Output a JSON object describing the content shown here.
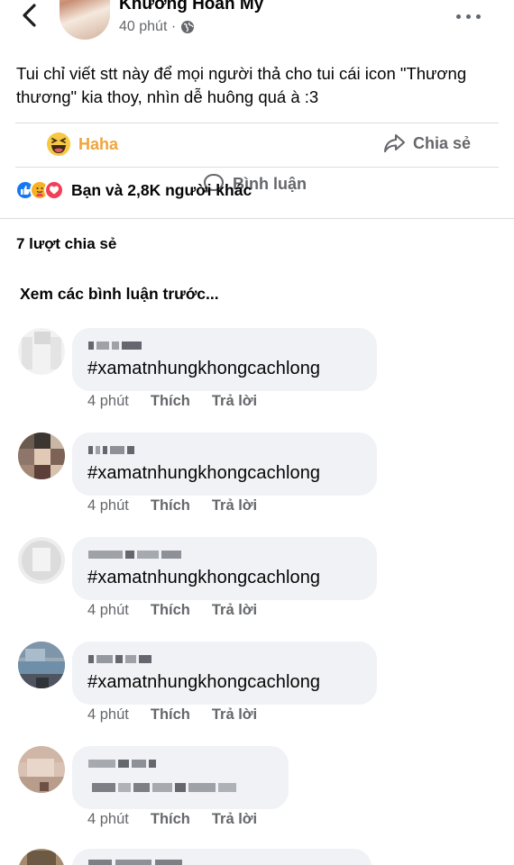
{
  "post": {
    "author": "Khương Hoàn My",
    "time": "40 phút ·",
    "text": "Tui chỉ viết stt này để mọi người thả cho tui cái icon \"Thương thương\" kia thoy, nhìn dễ huông quá à :3"
  },
  "actions": {
    "haha": "Haha",
    "comment": "Bình luận",
    "share": "Chia sẻ"
  },
  "reactions": {
    "summary": "Bạn và 2,8K người khác",
    "types": [
      "like-icon",
      "care-icon",
      "love-icon"
    ]
  },
  "shares": "7 lượt chia sẻ",
  "prev_comments": "Xem các bình luận trước...",
  "comments": [
    {
      "text": "#xamatnhungkhongcachlong",
      "time": "4 phút",
      "like": "Thích",
      "reply": "Trả lời"
    },
    {
      "text": "#xamatnhungkhongcachlong",
      "time": "4 phút",
      "like": "Thích",
      "reply": "Trả lời"
    },
    {
      "text": "#xamatnhungkhongcachlong",
      "time": "4 phút",
      "like": "Thích",
      "reply": "Trả lời"
    },
    {
      "text": "#xamatnhungkhongcachlong",
      "time": "4 phút",
      "like": "Thích",
      "reply": "Trả lời"
    },
    {
      "text": "",
      "time": "4 phút",
      "like": "Thích",
      "reply": "Trả lời"
    }
  ],
  "colors": {
    "haha": "#f0a53a",
    "secondary_text": "#65676b",
    "bubble": "#f0f2f5"
  }
}
